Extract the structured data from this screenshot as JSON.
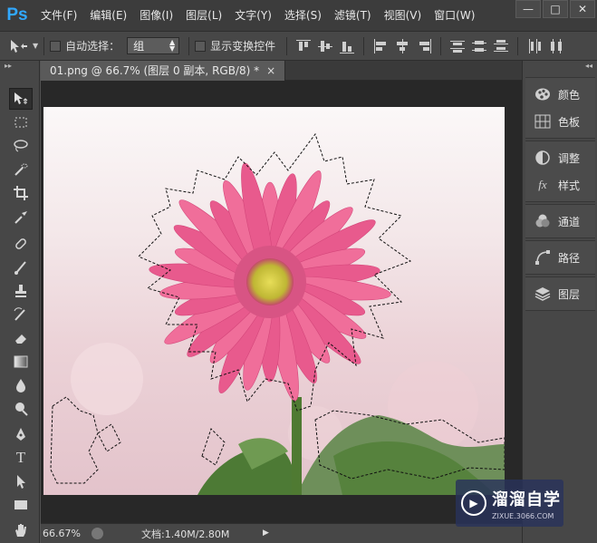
{
  "app": {
    "logo": "Ps"
  },
  "menu": [
    "文件(F)",
    "编辑(E)",
    "图像(I)",
    "图层(L)",
    "文字(Y)",
    "选择(S)",
    "滤镜(T)",
    "视图(V)",
    "窗口(W)"
  ],
  "window_controls": {
    "minimize": "—",
    "restore": "□",
    "close": "✕"
  },
  "options": {
    "auto_select_label": "自动选择：",
    "auto_select_value": "组",
    "transform_controls_label": "显示变换控件"
  },
  "document": {
    "tab_title": "01.png @ 66.7% (图层 0 副本, RGB/8) *",
    "close": "×"
  },
  "status": {
    "zoom": "66.67%",
    "doc_size": "文档:1.40M/2.80M"
  },
  "panels": [
    {
      "label": "颜色",
      "icon": "palette-icon"
    },
    {
      "label": "色板",
      "icon": "swatches-icon"
    },
    {
      "label": "调整",
      "icon": "adjustments-icon"
    },
    {
      "label": "样式",
      "icon": "styles-icon"
    },
    {
      "label": "通道",
      "icon": "channels-icon"
    },
    {
      "label": "路径",
      "icon": "paths-icon"
    },
    {
      "label": "图层",
      "icon": "layers-icon"
    }
  ],
  "watermark": {
    "text": "溜溜自学",
    "sub": "ZIXUE.3066.COM"
  },
  "colors": {
    "app_bg": "#535353",
    "accent": "#31a8ff",
    "flower": "#e8588a",
    "center": "#c9c23a"
  }
}
